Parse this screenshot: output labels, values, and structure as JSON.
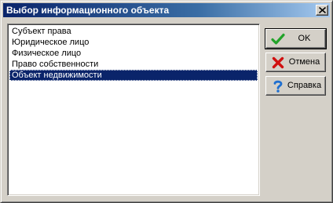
{
  "window": {
    "title": "Выбор информационного объекта"
  },
  "list": {
    "items": [
      "Субъект права",
      "Юридическое лицо",
      "Физическое лицо",
      "Право собственности",
      "Объект недвижимости"
    ],
    "selected": "Объект недвижимости"
  },
  "buttons": {
    "ok_label": "OK",
    "cancel_label": "Отмена",
    "help_label": "Справка"
  },
  "icons": {
    "ok": "green-checkmark-icon",
    "cancel": "red-x-icon",
    "help": "question-mark-icon",
    "close": "close-icon"
  },
  "colors": {
    "title_bar_start": "#0a246a",
    "title_bar_end": "#a6caf0",
    "selection": "#0a246a",
    "dialog_face": "#d4d0c8",
    "ok_icon": "#22a32a",
    "cancel_icon": "#d01010",
    "help_icon": "#1f6fd0"
  }
}
